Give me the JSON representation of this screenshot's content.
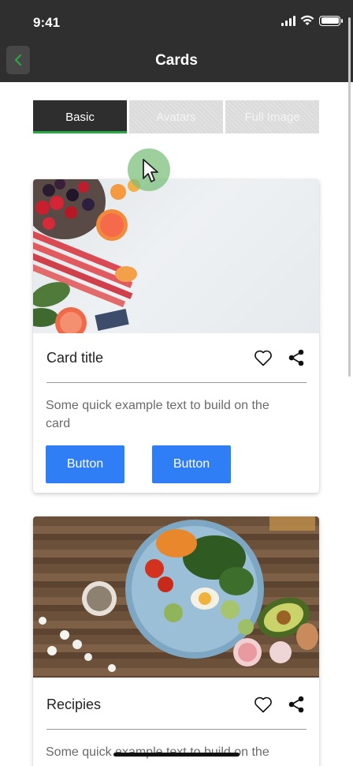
{
  "status_bar": {
    "time": "9:41"
  },
  "header": {
    "title": "Cards",
    "back_icon": "chevron-left-icon",
    "accent": "#27a843"
  },
  "tabs": [
    {
      "label": "Basic",
      "active": true
    },
    {
      "label": "Avatars",
      "active": false
    },
    {
      "label": "Full Image",
      "active": false
    }
  ],
  "cards": [
    {
      "image": "fruit-vegetables-photo",
      "title": "Card title",
      "text": "Some quick example text to build on the card",
      "buttons": [
        "Button",
        "Button"
      ]
    },
    {
      "image": "salad-bowl-photo",
      "title": "Recipies",
      "text": "Some quick example text to build on the"
    }
  ],
  "colors": {
    "header_bg": "#2f2f2f",
    "button": "#2f7ef5",
    "tab_active": "#2e2e2e"
  }
}
